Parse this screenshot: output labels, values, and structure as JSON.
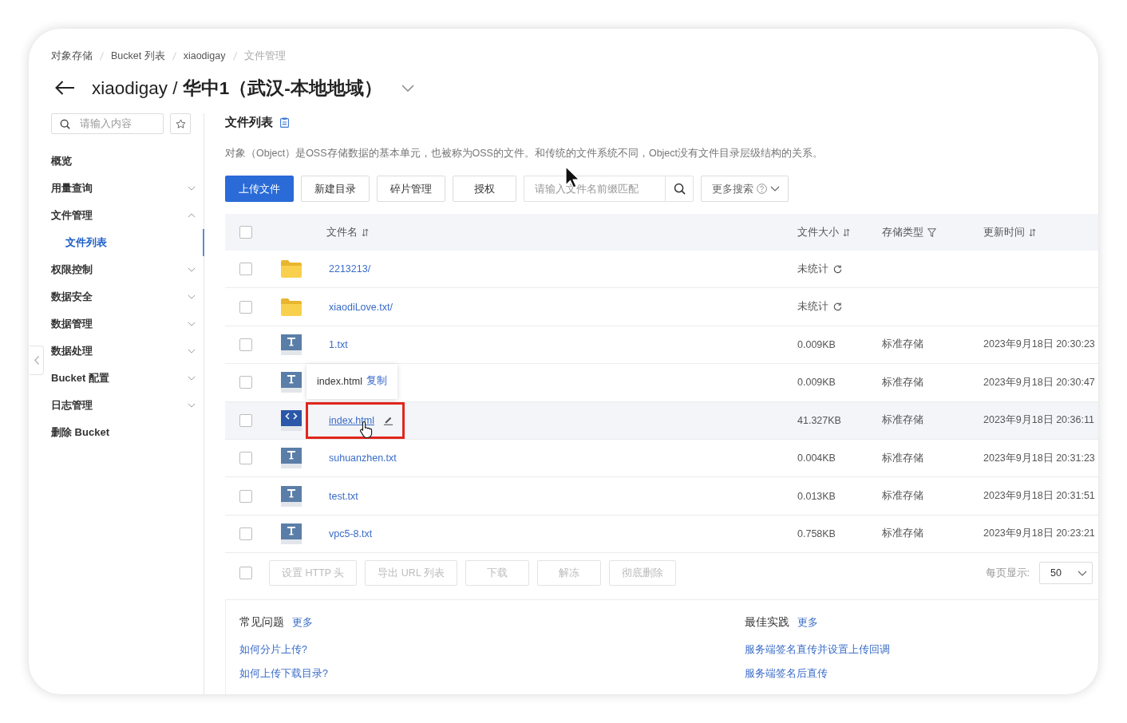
{
  "breadcrumb": [
    {
      "label": "对象存储",
      "current": false
    },
    {
      "label": "Bucket 列表",
      "current": false
    },
    {
      "label": "xiaodigay",
      "current": false
    },
    {
      "label": "文件管理",
      "current": true
    }
  ],
  "header": {
    "title": "xiaodigay / **华中1（武汉-本地地域）**"
  },
  "sidebar": {
    "search": {
      "placeholder": "请输入内容"
    },
    "items": [
      {
        "label": "概览",
        "kind": "link",
        "selected": false
      },
      {
        "label": "用量查询",
        "kind": "group",
        "expanded": false,
        "selected": false
      },
      {
        "label": "文件管理",
        "kind": "group",
        "expanded": true,
        "selected": false,
        "children": [
          {
            "label": "文件列表",
            "selected": true
          }
        ]
      },
      {
        "label": "权限控制",
        "kind": "group",
        "expanded": false,
        "selected": false
      },
      {
        "label": "数据安全",
        "kind": "group",
        "expanded": false,
        "selected": false
      },
      {
        "label": "数据管理",
        "kind": "group",
        "expanded": false,
        "selected": false
      },
      {
        "label": "数据处理",
        "kind": "group",
        "expanded": false,
        "selected": false
      },
      {
        "label": "Bucket 配置",
        "kind": "group",
        "expanded": false,
        "selected": false
      },
      {
        "label": "日志管理",
        "kind": "group",
        "expanded": false,
        "selected": false
      },
      {
        "label": "删除 Bucket",
        "kind": "link",
        "selected": false
      }
    ]
  },
  "content": {
    "title": "文件列表",
    "description": "对象（Object）是OSS存储数据的基本单元，也被称为OSS的文件。和传统的文件系统不同，Object没有文件目录层级结构的关系。"
  },
  "toolbar": {
    "buttons": [
      {
        "label": "上传文件",
        "kind": "primary"
      },
      {
        "label": "新建目录",
        "kind": "default"
      },
      {
        "label": "碎片管理",
        "kind": "default"
      },
      {
        "label": "授权",
        "kind": "default"
      }
    ],
    "search": {
      "placeholder": "请输入文件名前缀匹配"
    },
    "more_search": {
      "label": "更多搜索"
    }
  },
  "table": {
    "select_all": {
      "checked": false
    },
    "columns": [
      {
        "label": "文件名",
        "kind": "sort"
      },
      {
        "label": "文件大小",
        "kind": "sort"
      },
      {
        "label": "存储类型",
        "kind": "filter"
      },
      {
        "label": "更新时间",
        "kind": "sort"
      }
    ],
    "rows": [
      {
        "kind": "folder",
        "name": "2213213/",
        "size": "未统计",
        "checked": false,
        "hovered": false,
        "highlighted": false
      },
      {
        "kind": "folder",
        "name": "xiaodiLove.txt/",
        "size": "未统计",
        "checked": false,
        "hovered": false,
        "highlighted": false
      },
      {
        "kind": "text",
        "name": "1.txt",
        "size": "0.009KB",
        "storage": "标准存储",
        "updated": "2023年9月18日 20:30:23",
        "checked": false,
        "hovered": false,
        "highlighted": false
      },
      {
        "kind": "text",
        "size": "0.009KB",
        "storage": "标准存储",
        "updated": "2023年9月18日 20:30:47",
        "checked": false,
        "hovered": false,
        "highlighted": false
      },
      {
        "kind": "code",
        "name": "index.html",
        "size": "41.327KB",
        "storage": "标准存储",
        "updated": "2023年9月18日 20:36:11",
        "checked": false,
        "hovered": true,
        "highlighted": true,
        "tooltip": {
          "text": "index.html",
          "action": "复制"
        }
      },
      {
        "kind": "text",
        "name": "suhuanzhen.txt",
        "size": "0.004KB",
        "storage": "标准存储",
        "updated": "2023年9月18日 20:31:23",
        "checked": false,
        "hovered": false,
        "highlighted": false
      },
      {
        "kind": "text",
        "name": "test.txt",
        "size": "0.013KB",
        "storage": "标准存储",
        "updated": "2023年9月18日 20:31:51",
        "checked": false,
        "hovered": false,
        "highlighted": false
      },
      {
        "kind": "text",
        "name": "vpc5-8.txt",
        "size": "0.758KB",
        "storage": "标准存储",
        "updated": "2023年9月18日 20:23:21",
        "checked": false,
        "hovered": false,
        "highlighted": false
      }
    ]
  },
  "bulk_actions": {
    "checked": false,
    "buttons": [
      {
        "label": "设置 HTTP 头",
        "disabled": true
      },
      {
        "label": "导出 URL 列表",
        "disabled": true
      },
      {
        "label": "下载",
        "disabled": true
      },
      {
        "label": "解冻",
        "disabled": true
      },
      {
        "label": "彻底删除",
        "disabled": true
      }
    ]
  },
  "page_size": {
    "label": "每页显示:",
    "value": "50"
  },
  "help": [
    {
      "title": "常见问题",
      "more": "更多",
      "links": [
        "如何分片上传?",
        "如何上传下载目录?"
      ]
    },
    {
      "title": "最佳实践",
      "more": "更多",
      "links": [
        "服务端签名直传并设置上传回调",
        "服务端签名后直传"
      ]
    }
  ]
}
